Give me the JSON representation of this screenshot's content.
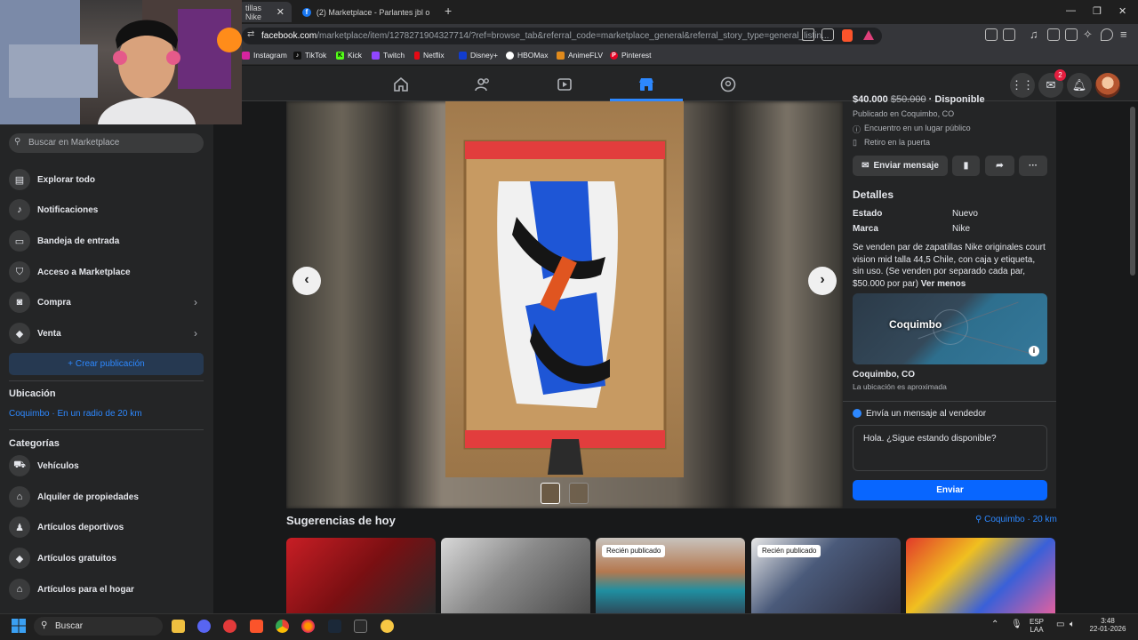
{
  "browser": {
    "tabs": [
      {
        "label": "tillas Nike",
        "active": true
      },
      {
        "label": "(2) Marketplace - Parlantes jbl origina",
        "active": false
      }
    ],
    "url_host": "facebook.com",
    "url_path": "/marketplace/item/1278271904327714/?ref=browse_tab&referral_code=marketplace_general&referral_story_type=general_listin...",
    "bookmarks": [
      "Instagram",
      "TikTok",
      "Kick",
      "Twitch",
      "Netflix",
      "Disney+",
      "HBOMax",
      "AnimeFLV",
      "Pinterest"
    ],
    "colors": {
      "tabbar": "#1f1f1f",
      "toolbar": "#35363a",
      "brave": "#fb542b"
    }
  },
  "fb_nav": {
    "icons": [
      "home-icon",
      "friends-icon",
      "video-icon",
      "marketplace-icon",
      "groups-icon"
    ],
    "active": "marketplace-icon",
    "messenger_badge": "2",
    "accent": "#2d88ff"
  },
  "sidebar": {
    "search_placeholder": "Buscar en Marketplace",
    "items": [
      {
        "label": "Explorar todo",
        "icon": "store-icon"
      },
      {
        "label": "Notificaciones",
        "icon": "bell-icon"
      },
      {
        "label": "Bandeja de entrada",
        "icon": "inbox-icon"
      },
      {
        "label": "Acceso a Marketplace",
        "icon": "shield-icon"
      },
      {
        "label": "Compra",
        "icon": "bag-icon",
        "chevron": true
      },
      {
        "label": "Venta",
        "icon": "tag-icon",
        "chevron": true
      }
    ],
    "create_label": "+ Crear publicación",
    "location_heading": "Ubicación",
    "location_value": "Coquimbo · En un radio de 20 km",
    "categories_heading": "Categorías",
    "categories": [
      {
        "label": "Vehículos",
        "icon": "car-icon"
      },
      {
        "label": "Alquiler de propiedades",
        "icon": "house-icon"
      },
      {
        "label": "Artículos deportivos",
        "icon": "runner-icon"
      },
      {
        "label": "Artículos gratuitos",
        "icon": "tag-icon"
      },
      {
        "label": "Artículos para el hogar",
        "icon": "home-icon"
      }
    ]
  },
  "listing": {
    "price": "$40.000",
    "old_price": "$50.000",
    "status": "· Disponible",
    "published": "Publicado en Coquimbo, CO",
    "meetup": "Encuentro en un lugar público",
    "pickup": "Retiro en la puerta",
    "send_message_label": "Enviar mensaje",
    "details_heading": "Detalles",
    "details": [
      {
        "key": "Estado",
        "value": "Nuevo"
      },
      {
        "key": "Marca",
        "value": "Nike"
      }
    ],
    "description": "Se venden par de zapatillas Nike originales court vision mid talla 44,5 Chile, con caja y etiqueta, sin uso. (Se venden por separado cada par, $50.000 por par)",
    "see_less": "Ver menos",
    "map_label": "Coquimbo",
    "location_title": "Coquimbo, CO",
    "location_note": "La ubicación es aproximada",
    "seller_msg_heading": "Envía un mensaje al vendedor",
    "message_text": "Hola. ¿Sigue estando disponible?",
    "send_label": "Enviar"
  },
  "suggestions": {
    "title": "Sugerencias de hoy",
    "location": "Coquimbo · 20 km",
    "cards": [
      {
        "tag": ""
      },
      {
        "tag": ""
      },
      {
        "tag": "Recién publicado"
      },
      {
        "tag": "Recién publicado"
      },
      {
        "tag": ""
      }
    ]
  },
  "taskbar": {
    "search_label": "Buscar",
    "lang_top": "ESP",
    "lang_bottom": "LAA",
    "time": "3:48",
    "date": "22-01-2026"
  }
}
